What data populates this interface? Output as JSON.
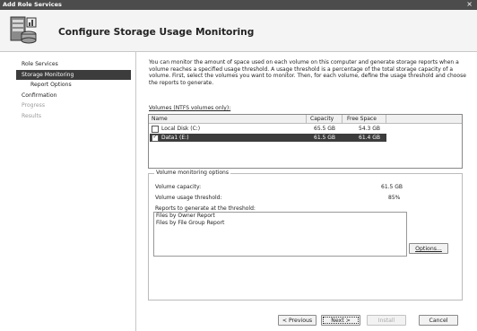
{
  "window": {
    "title": "Add Role Services"
  },
  "header": {
    "title": "Configure Storage Usage Monitoring",
    "icon": "server-disk-icon"
  },
  "sidebar": {
    "items": [
      {
        "label": "Role Services",
        "state": "normal"
      },
      {
        "label": "Storage Monitoring",
        "state": "active"
      },
      {
        "label": "Report Options",
        "state": "indent"
      },
      {
        "label": "Confirmation",
        "state": "normal"
      },
      {
        "label": "Progress",
        "state": "dim"
      },
      {
        "label": "Results",
        "state": "dim"
      }
    ]
  },
  "main": {
    "description": "You can monitor the amount of space used on each volume on this computer and generate storage reports when a volume reaches a specified usage threshold. A usage threshold is a percentage of the total storage capacity of a volume. First, select the volumes you want to monitor. Then, for each volume, define the usage threshold and choose the reports to generate.",
    "volumes_label": "Volumes (NTFS volumes only):",
    "columns": [
      "Name",
      "Capacity",
      "Free Space"
    ],
    "volumes": [
      {
        "name": "Local Disk (C:)",
        "capacity": "65.5 GB",
        "free": "54.3 GB",
        "checked": false,
        "selected": false
      },
      {
        "name": "Data1 (E:)",
        "capacity": "61.5 GB",
        "free": "61.4 GB",
        "checked": true,
        "selected": true
      }
    ],
    "options": {
      "legend": "Volume monitoring options",
      "capacity_label": "Volume capacity:",
      "capacity_value": "61.5 GB",
      "threshold_label": "Volume usage threshold:",
      "threshold_value": "85%",
      "reports_label": "Reports to generate at the threshold:",
      "reports": [
        "Files by Owner Report",
        "Files by File Group Report"
      ],
      "options_button": "Options..."
    }
  },
  "footer": {
    "previous": "< Previous",
    "next": "Next >",
    "install": "Install",
    "cancel": "Cancel"
  }
}
